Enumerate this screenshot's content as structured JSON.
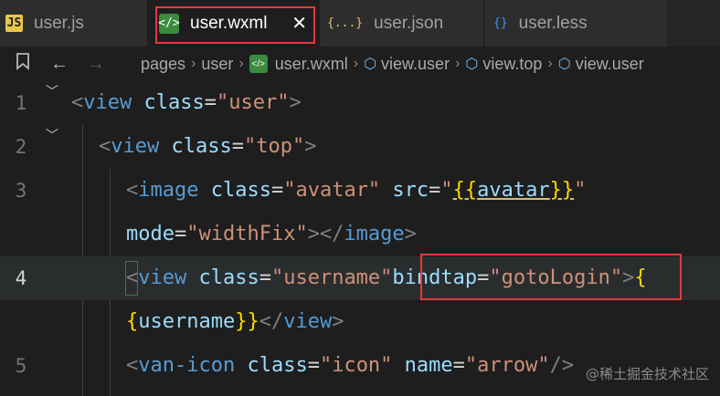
{
  "tabs": [
    {
      "icon": "JS",
      "label": "user.js"
    },
    {
      "icon": "</>",
      "label": "user.wxml",
      "close": "✕"
    },
    {
      "icon": "{...}",
      "label": "user.json"
    },
    {
      "icon": "{}",
      "label": "user.less"
    }
  ],
  "breadcrumb": {
    "items": [
      "pages",
      "user",
      "user.wxml",
      "view.user",
      "view.top",
      "view.user"
    ]
  },
  "editor": {
    "line_numbers": [
      "1",
      "2",
      "3",
      "4",
      "5"
    ],
    "lines": [
      {
        "a": "<",
        "b": "view",
        "c": " class",
        "d": "=",
        "e": "\"user\"",
        "f": ">"
      },
      {
        "a": "<",
        "b": "view",
        "c": " class",
        "d": "=",
        "e": "\"top\"",
        "f": ">"
      },
      {
        "a": "<",
        "b": "image",
        "c": " class",
        "d": "=",
        "e": "\"avatar\"",
        "g": " src",
        "h": "=",
        "i": "\"",
        "j": "{{",
        "k": "avatar",
        "l": "}}",
        "m": "\""
      },
      {
        "a": "mode",
        "b": "=",
        "c": "\"widthFix\"",
        "d": "></",
        "e": "image",
        "f": ">"
      },
      {
        "a": "<",
        "b": "view",
        "c": " class",
        "d": "=",
        "e": "\"username\"",
        "g": "bindtap",
        "h": "=",
        "i": "\"gotoLogin\"",
        "j": ">",
        "k": "{"
      },
      {
        "a": "{",
        "b": "username",
        "c": "}}",
        "d": "</",
        "e": "view",
        "f": ">"
      },
      {
        "a": "<",
        "b": "van-icon",
        "c": " class",
        "d": "=",
        "e": "\"icon\"",
        "g": " name",
        "h": "=",
        "i": "\"arrow\"",
        "j": "/>"
      }
    ]
  },
  "watermark": "@稀土掘金技术社区"
}
